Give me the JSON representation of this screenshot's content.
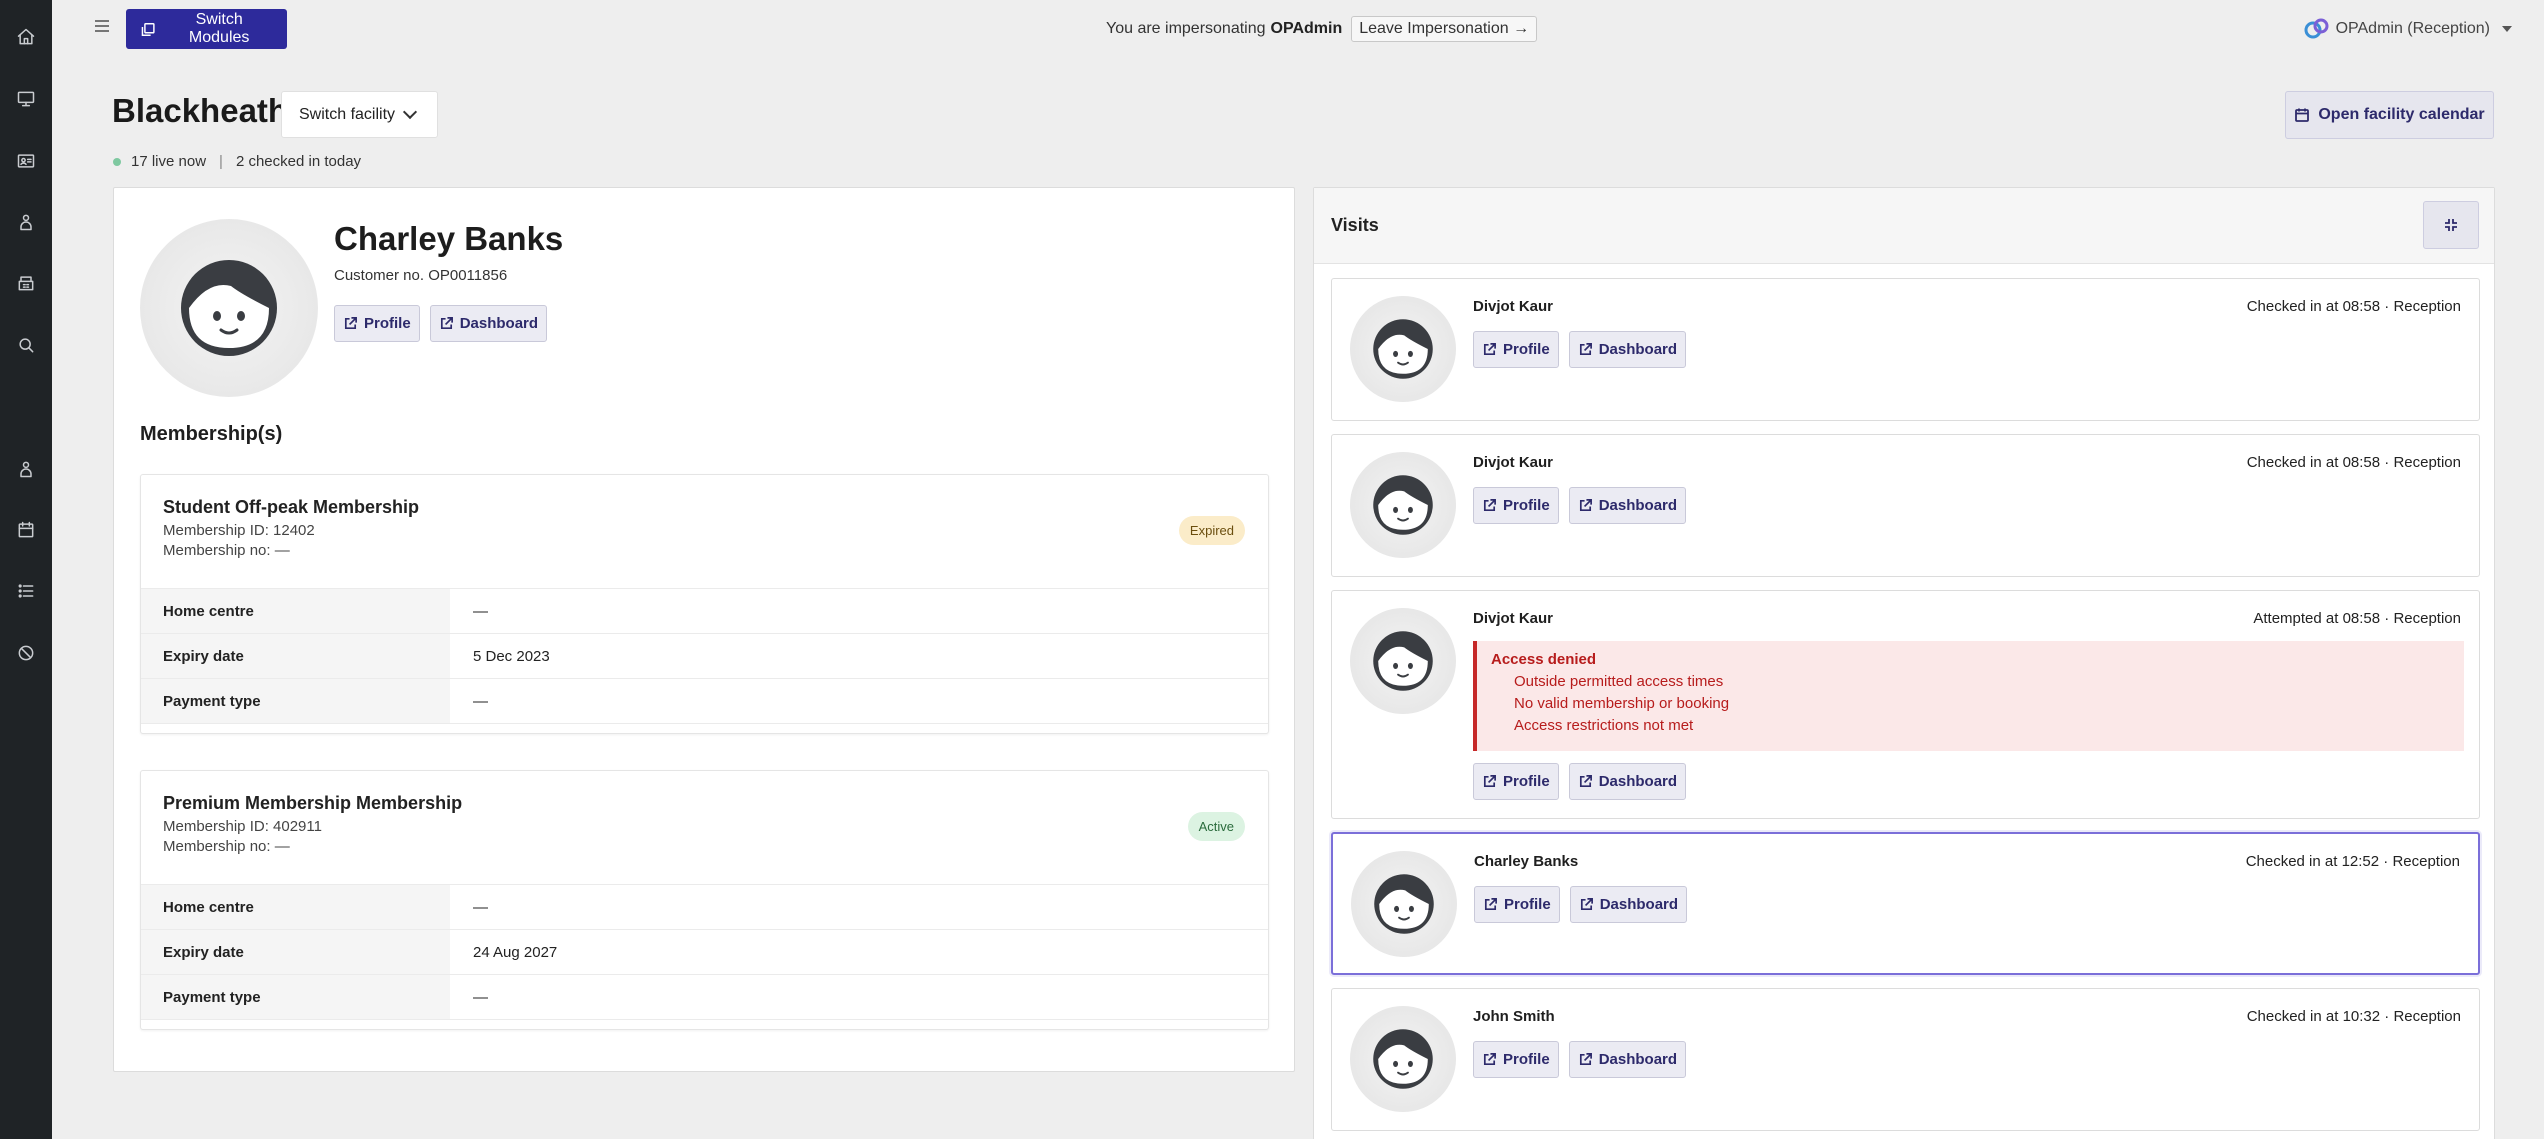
{
  "topbar": {
    "switch_modules": "Switch Modules",
    "impersonating_text": "You are impersonating",
    "impersonated_user": "OPAdmin",
    "leave_impersonation": "Leave Impersonation →",
    "user_label": "OPAdmin (Reception)"
  },
  "facility": {
    "name": "Blackheath",
    "switch_label": "Switch facility",
    "open_calendar": "Open facility calendar",
    "live_now": "17 live now",
    "separator": "|",
    "checked_in_today": "2 checked in today"
  },
  "customer": {
    "name": "Charley Banks",
    "customer_no": "Customer no. OP0011856",
    "profile_label": "Profile",
    "dashboard_label": "Dashboard",
    "memberships_heading": "Membership(s)"
  },
  "memberships": [
    {
      "title": "Student Off-peak Membership",
      "membership_id": "Membership ID: 12402",
      "membership_no": "Membership no: —",
      "status": "Expired",
      "rows": [
        {
          "key": "Home centre",
          "value": "—"
        },
        {
          "key": "Expiry date",
          "value": "5 Dec 2023"
        },
        {
          "key": "Payment type",
          "value": "—"
        }
      ]
    },
    {
      "title": "Premium Membership Membership",
      "membership_id": "Membership ID: 402911",
      "membership_no": "Membership no: —",
      "status": "Active",
      "rows": [
        {
          "key": "Home centre",
          "value": "—"
        },
        {
          "key": "Expiry date",
          "value": "24 Aug 2027"
        },
        {
          "key": "Payment type",
          "value": "—"
        }
      ]
    }
  ],
  "visits": {
    "heading": "Visits",
    "items": [
      {
        "name": "Divjot Kaur",
        "status": "Checked in at 08:58 · Reception",
        "profile": "Profile",
        "dashboard": "Dashboard"
      },
      {
        "name": "Divjot Kaur",
        "status": "Checked in at 08:58 · Reception",
        "profile": "Profile",
        "dashboard": "Dashboard"
      },
      {
        "name": "Divjot Kaur",
        "status": "Attempted at 08:58 · Reception",
        "profile": "Profile",
        "dashboard": "Dashboard",
        "denied": {
          "title": "Access denied",
          "reasons": [
            "Outside permitted access times",
            "No valid membership or booking",
            "Access restrictions not met"
          ]
        }
      },
      {
        "name": "Charley Banks",
        "status": "Checked in at 12:52 · Reception",
        "profile": "Profile",
        "dashboard": "Dashboard"
      },
      {
        "name": "John Smith",
        "status": "Checked in at 10:32 · Reception",
        "profile": "Profile",
        "dashboard": "Dashboard"
      }
    ]
  },
  "colors": {
    "sidebar": "#1f2326",
    "primary": "#2d2a9b",
    "link_text": "#2d2a6b",
    "expired_badge": "#fbecc9",
    "active_badge": "#dcf3e2",
    "denied": "#c62828",
    "selected_border": "#7b6fd9",
    "live_dot": "#7ec8a0"
  },
  "icons": {
    "sidebar": [
      "home-icon",
      "monitor-icon",
      "id-card-icon",
      "person-icon",
      "building-icon",
      "search-icon",
      "person-alt-icon",
      "calendar-icon",
      "list-icon",
      "blocked-icon"
    ]
  }
}
